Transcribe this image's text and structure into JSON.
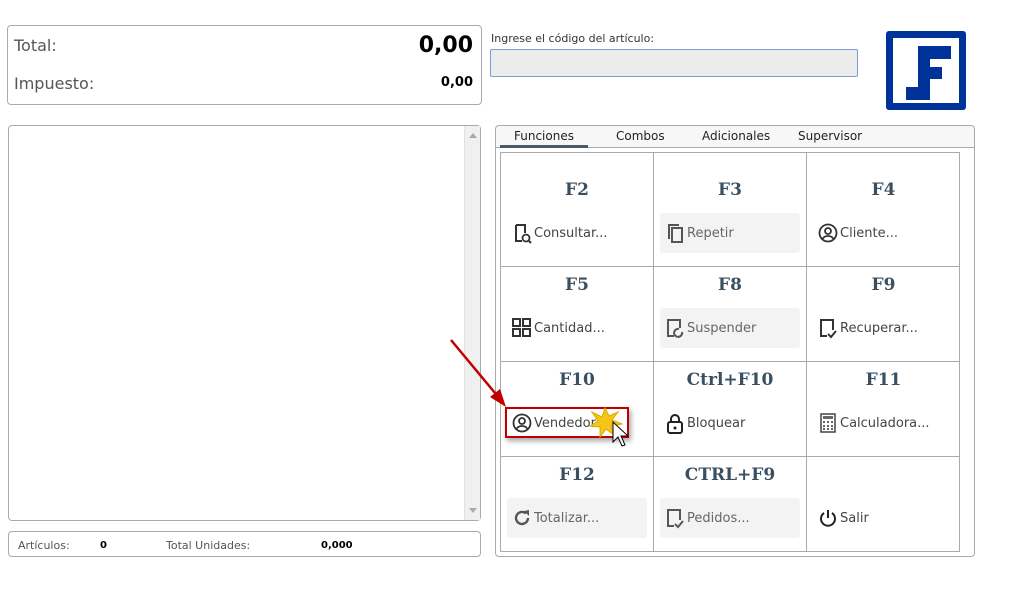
{
  "totals": {
    "total_label": "Total:",
    "total_value": "0,00",
    "tax_label": "Impuesto:",
    "tax_value": "0,00"
  },
  "code_input": {
    "label": "Ingrese el código del artículo:",
    "value": ""
  },
  "footer": {
    "items_label": "Artículos:",
    "items_value": "0",
    "units_label": "Total Unidades:",
    "units_value": "0,000"
  },
  "tabs": [
    {
      "label": "Funciones",
      "active": true
    },
    {
      "label": "Combos"
    },
    {
      "label": "Adicionales"
    },
    {
      "label": "Supervisor"
    }
  ],
  "functions": [
    {
      "key": "F2",
      "label": "Consultar...",
      "icon": "search-document-icon"
    },
    {
      "key": "F3",
      "label": "Repetir",
      "icon": "copy-icon",
      "disabled": true
    },
    {
      "key": "F4",
      "label": "Cliente...",
      "icon": "user-circle-icon"
    },
    {
      "key": "F5",
      "label": "Cantidad...",
      "icon": "grid-icon"
    },
    {
      "key": "F8",
      "label": "Suspender",
      "icon": "suspend-icon",
      "disabled": true
    },
    {
      "key": "F9",
      "label": "Recuperar...",
      "icon": "recover-icon"
    },
    {
      "key": "F10",
      "label": "Vendedor...",
      "icon": "user-circle-icon"
    },
    {
      "key": "Ctrl+F10",
      "label": "Bloquear",
      "icon": "lock-icon"
    },
    {
      "key": "F11",
      "label": "Calculadora...",
      "icon": "calculator-icon"
    },
    {
      "key": "F12",
      "label": "Totalizar...",
      "icon": "refresh-icon",
      "disabled": true
    },
    {
      "key": "CTRL+F9",
      "label": "Pedidos...",
      "icon": "orders-icon",
      "disabled": true
    },
    {
      "key": "",
      "label": "Salir",
      "icon": "power-icon"
    }
  ],
  "colors": {
    "logo_blue": "#003399",
    "key_text": "#3a5060",
    "highlight": "#c00000"
  }
}
